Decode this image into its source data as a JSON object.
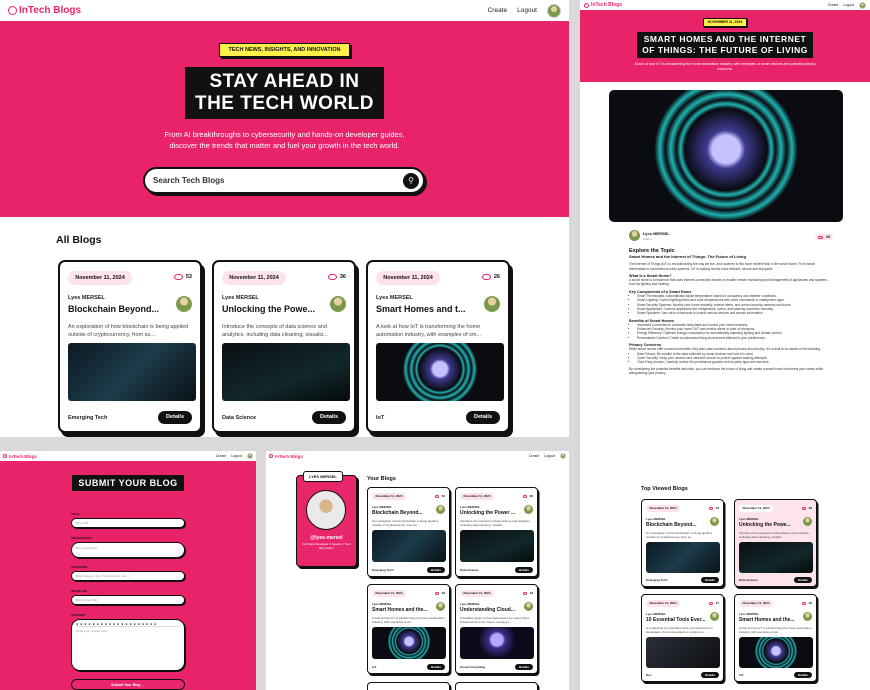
{
  "brand": {
    "name": "InTech Blogs"
  },
  "nav": {
    "create": "Create",
    "logout": "Logout"
  },
  "home": {
    "badge": "TECH NEWS, INSIGHTS, AND INNOVATION",
    "headline_line1": "STAY AHEAD IN",
    "headline_line2": "THE TECH WORLD",
    "sub_line1": "From AI breakthroughs to cybersecurity and hands-on developer guides,",
    "sub_line2": "discover the trends that matter and fuel your growth in the tech world.",
    "search_placeholder": "Search Tech Blogs",
    "section_title": "All Blogs",
    "cards": [
      {
        "date": "November 11, 2024",
        "views": "53",
        "author": "Lyes MERSEL",
        "title": "Blockchain Beyond...",
        "desc": "An exploration of how blockchain is being applied outside of cryptocurrency, from su...",
        "category": "Emerging Tech",
        "button": "Details"
      },
      {
        "date": "November 11, 2024",
        "views": "36",
        "author": "Lyes MERSEL",
        "title": "Unlocking the Powe...",
        "desc": "Introduce the concepts of data science and analytics, including data cleaning, visualiz...",
        "category": "Data Science",
        "button": "Details"
      },
      {
        "date": "November 11, 2024",
        "views": "26",
        "author": "Lyes MERSEL",
        "title": "Smart Homes and t...",
        "desc": "A look at how IoT is transforming the home automation industry, with examples of sm...",
        "category": "IoT",
        "button": "Details"
      }
    ]
  },
  "article": {
    "date": "NOVEMBER 11, 2024",
    "title_line1": "SMART HOMES AND THE INTERNET",
    "title_line2": "OF THINGS: THE FUTURE OF LIVING",
    "summary": "A look at how IoT is transforming the home automation industry, with examples of smart devices and potential privacy concerns.",
    "author": "Lyes MERSEL",
    "author_role": "Author",
    "views": "26",
    "explore": "Explore the Topic",
    "explore_sub": "Smart Homes and the Internet of Things: The Future of Living",
    "intro": "The Internet of Things (IoT) is revolutionizing the way we live, and nowhere is this more evident than in the smart home. From smart thermostats to connected security systems, IoT is making homes more efficient, secure and enjoyable.",
    "h_what": "What Is a Smart Home?",
    "p_what": "A smart home is a residence that uses internet-connected devices to enable remote monitoring and management of appliances and systems, such as lighting and heating.",
    "h_components": "Key Components of a Smart Home",
    "components": [
      "Smart Thermostats: Automatically adjust temperature based on occupancy and weather conditions.",
      "Smart Lighting: Control lighting levels and color temperatures with voice commands or smartphone apps.",
      "Smart Security Systems: Monitor your home remotely, receive alerts, and control security cameras and doors.",
      "Smart Appliances: Connect appliances like refrigerators, ovens, and washing machines remotely.",
      "Smart Speakers: Use voice commands to control various devices and access information."
    ],
    "h_benefits": "Benefits of Smart Homes",
    "benefits": [
      "Increased Convenience: Automate daily tasks and control your home remotely.",
      "Enhanced Security: Monitor your home 24/7 and receive alerts in case of intrusions.",
      "Energy Efficiency: Optimize energy consumption by automatically adjusting lighting and climate control.",
      "Personalized Comfort: Create a customized living environment tailored to your preferences."
    ],
    "h_privacy": "Privacy Concerns",
    "p_privacy": "While smart homes offer numerous benefits, they also raise concerns about privacy and security. It's crucial to be aware of the following:",
    "privacy": [
      "Data Privacy: Be mindful of the data collected by smart devices and how it is used.",
      "Cyber Security: Keep your devices and networks secure to protect against hacking attempts.",
      "Third-Party Access: Carefully review the permissions granted to third-party apps and services."
    ],
    "outro": "By considering the potential benefits and risks, you can embrace the future of living and create a smart home that meets your needs while safeguarding your privacy.",
    "top_title": "Top Viewed Blogs",
    "top_cards": [
      {
        "date": "November 11, 2024",
        "views": "53",
        "author": "Lyes MERSEL",
        "title": "Blockchain Beyond...",
        "desc": "An exploration of how blockchain is being applied outside of cryptocurrency, from su...",
        "category": "Emerging Tech",
        "button": "Details"
      },
      {
        "date": "November 11, 2024",
        "views": "36",
        "author": "Lyes MERSEL",
        "title": "Unlocking the Powe...",
        "desc": "Introduce the concepts of data science and analytics, including data cleaning, visualiz...",
        "category": "Data Science",
        "button": "Details"
      },
      {
        "date": "November 11, 2024",
        "views": "27",
        "author": "Lyes MERSEL",
        "title": "10 Essential Tools Ever...",
        "desc": "A curated list of must-have tools and resources for developers, from code editors to version co...",
        "category": "Dev",
        "button": "Details"
      },
      {
        "date": "November 11, 2024",
        "views": "26",
        "author": "Lyes MERSEL",
        "title": "Smart Homes and the...",
        "desc": "A look at how IoT is transforming the home automation industry, with examples of sm...",
        "category": "IoT",
        "button": "Details"
      }
    ]
  },
  "submit": {
    "title": "SUBMIT YOUR BLOG",
    "title_label": "TITLE",
    "title_placeholder": "Blog Title",
    "desc_label": "DESCRIPTION",
    "desc_placeholder": "Blog Description",
    "cat_label": "CATEGORY",
    "cat_placeholder": "Blog Category (Ex. Cybersecurity, Ecc..)",
    "img_label": "IMAGE URL",
    "img_placeholder": "Blog Image URL",
    "content_label": "CONTENT",
    "content_placeholder": "Write your content here...",
    "button": "Submit Your Blog"
  },
  "profile": {
    "name_tag": "LYES MERSEL",
    "handle": "@lyes-mersel",
    "bio": "Full Stack Developer & Speaker | Tech Blog Author",
    "your_blogs": "Your Blogs",
    "cards": [
      {
        "date": "November 11, 2024",
        "views": "53",
        "author": "Lyes MERSEL",
        "title": "Blockchain Beyond...",
        "desc": "An exploration of how blockchain is being applied outside of cryptocurrency, from su...",
        "category": "Emerging Tech",
        "button": "Details"
      },
      {
        "date": "November 11, 2024",
        "views": "36",
        "author": "Lyes MERSEL",
        "title": "Unlocking the Power ...",
        "desc": "Introduce the concepts of data science and analytics, including data cleaning, visualiz...",
        "category": "Data Science",
        "button": "Details"
      },
      {
        "date": "November 11, 2024",
        "views": "26",
        "author": "Lyes MERSEL",
        "title": "Smart Homes and the...",
        "desc": "A look at how IoT is transforming the home automation industry, with examples of sm...",
        "category": "IoT",
        "button": "Details"
      },
      {
        "date": "November 11, 2024",
        "views": "19",
        "author": "Lyes MERSEL",
        "title": "Understanding Cloud...",
        "desc": "A detailed guide on how businesses are using cloud infrastructure to the cloud, covering s...",
        "category": "Cloud Computing",
        "button": "Details"
      }
    ]
  }
}
